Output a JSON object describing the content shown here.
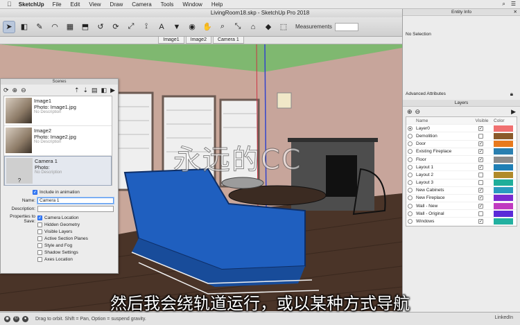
{
  "menubar": {
    "app_name": "SketchUp",
    "items": [
      "File",
      "Edit",
      "View",
      "Draw",
      "Camera",
      "Tools",
      "Window",
      "Help"
    ]
  },
  "window": {
    "title": "LivingRoom18.skp - SketchUp Pro 2018"
  },
  "toolbar": {
    "tools": [
      "select-icon",
      "eraser-icon",
      "pencil-icon",
      "arc-icon",
      "rectangle-icon",
      "push-pull-icon",
      "follow-me-icon",
      "rotate-icon",
      "scale-icon",
      "tape-measure-icon",
      "text-icon",
      "paint-bucket-icon",
      "orbit-icon",
      "pan-icon",
      "zoom-icon",
      "zoom-extents-icon",
      "warehouse-icon",
      "extension-icon",
      "share-icon"
    ],
    "tool_glyphs": [
      "➤",
      "◧",
      "✎",
      "◠",
      "▦",
      "⬒",
      "↺",
      "⟳",
      "⤢",
      "⟟",
      "A",
      "▼",
      "◉",
      "✋",
      "⌕",
      "⤡",
      "⌂",
      "◆",
      "⬚"
    ],
    "measurements_label": "Measurements",
    "measurements_value": ""
  },
  "scene_tabs": [
    "Image1",
    "Image2",
    "Camera 1"
  ],
  "scenes_panel": {
    "title": "Scenes",
    "items": [
      {
        "name": "Image1",
        "photo": "Photo: Image1.jpg",
        "desc": "No Description"
      },
      {
        "name": "Image2",
        "photo": "Photo: Image2.jpg",
        "desc": "No Description"
      },
      {
        "name": "Camera 1",
        "photo": "Photo:",
        "desc": "No Description"
      }
    ],
    "include_label": "Include in animation",
    "name_label": "Name:",
    "name_value": "Camera 1",
    "description_label": "Description:",
    "description_value": "",
    "properties_label_1": "Properties to",
    "properties_label_2": "Save:",
    "properties": [
      {
        "label": "Camera Location",
        "checked": true
      },
      {
        "label": "Hidden Geometry",
        "checked": false
      },
      {
        "label": "Visible Layers",
        "checked": false
      },
      {
        "label": "Active Section Planes",
        "checked": false
      },
      {
        "label": "Style and Fog",
        "checked": false
      },
      {
        "label": "Shadow Settings",
        "checked": false
      },
      {
        "label": "Axes Location",
        "checked": false
      }
    ]
  },
  "entity_info": {
    "title": "Entity Info",
    "no_selection": "No Selection",
    "advanced": "Advanced Attributes"
  },
  "layers": {
    "title": "Layers",
    "headers": {
      "name": "Name",
      "visible": "Visible",
      "color": "Color"
    },
    "rows": [
      {
        "name": "Layer0",
        "visible": true,
        "active": true,
        "color": "#f07070"
      },
      {
        "name": "Demolition",
        "visible": false,
        "active": false,
        "color": "#8a5a2a"
      },
      {
        "name": "Door",
        "visible": true,
        "active": false,
        "color": "#e87a1e"
      },
      {
        "name": "Existing Fireplace",
        "visible": true,
        "active": false,
        "color": "#2a7fb0"
      },
      {
        "name": "Floor",
        "visible": true,
        "active": false,
        "color": "#8c8c8c"
      },
      {
        "name": "Layout 1",
        "visible": true,
        "active": false,
        "color": "#1f7fb5"
      },
      {
        "name": "Layout 2",
        "visible": false,
        "active": false,
        "color": "#b08a2a"
      },
      {
        "name": "Layout 3",
        "visible": false,
        "active": false,
        "color": "#1fae9a"
      },
      {
        "name": "New Cabinets",
        "visible": true,
        "active": false,
        "color": "#2a9bbf"
      },
      {
        "name": "New Fireplace",
        "visible": true,
        "active": false,
        "color": "#7a2ad0"
      },
      {
        "name": "Wall - New",
        "visible": true,
        "active": false,
        "color": "#c03ac0"
      },
      {
        "name": "Wall - Original",
        "visible": false,
        "active": false,
        "color": "#5a2ad8"
      },
      {
        "name": "Windows",
        "visible": true,
        "active": false,
        "color": "#22b0a0"
      }
    ]
  },
  "statusbar": {
    "message": "Drag to orbit. Shift = Pan, Option = suspend gravity.",
    "right": "LinkedIn"
  },
  "overlays": {
    "watermark": "永远的CC",
    "subtitle": "然后我会绕轨道运行，或以某种方式导航"
  }
}
